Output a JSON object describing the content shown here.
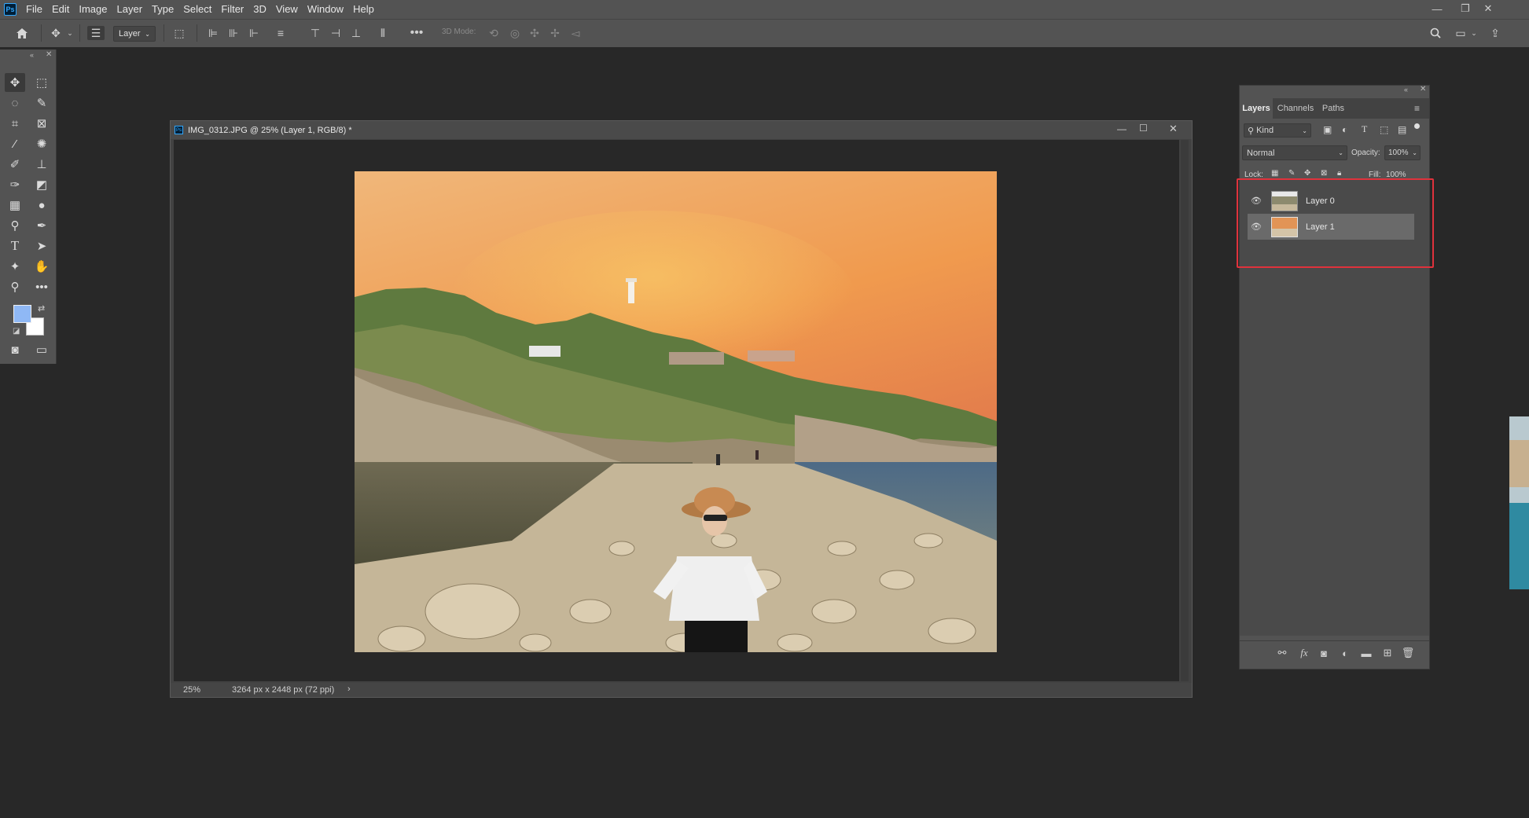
{
  "menubar": {
    "app_icon": "Ps",
    "items": [
      "File",
      "Edit",
      "Image",
      "Layer",
      "Type",
      "Select",
      "Filter",
      "3D",
      "View",
      "Window",
      "Help"
    ],
    "window_controls": [
      "—",
      "❐",
      "✕"
    ]
  },
  "options": {
    "auto_select_target": "Layer",
    "mode_3d_label": "3D Mode:"
  },
  "document": {
    "title": "IMG_0312.JPG @ 25% (Layer 1, RGB/8) *",
    "zoom": "25%",
    "info": "3264 px x 2448 px (72 ppi)"
  },
  "layers_panel": {
    "tabs": [
      "Layers",
      "Channels",
      "Paths"
    ],
    "filter_kind": "Kind",
    "blend_mode": "Normal",
    "opacity_label": "Opacity:",
    "opacity_value": "100%",
    "lock_label": "Lock:",
    "fill_label": "Fill:",
    "fill_value": "100%",
    "layers": [
      {
        "name": "Layer 0",
        "visible": true,
        "selected": false
      },
      {
        "name": "Layer 1",
        "visible": true,
        "selected": true
      }
    ]
  },
  "colors": {
    "foreground": "#8fb8f5",
    "background": "#ffffff",
    "highlight_box": "#e0323c"
  }
}
